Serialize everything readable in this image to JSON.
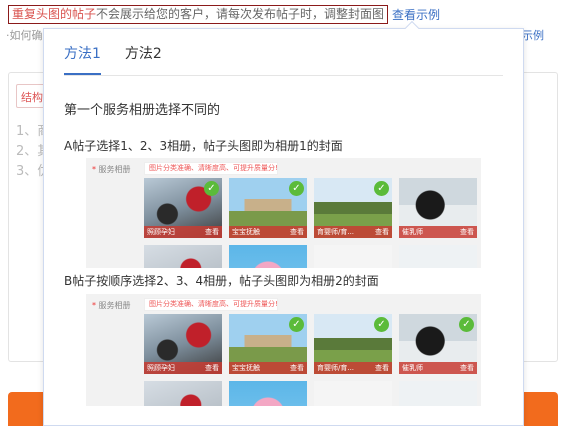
{
  "notice": {
    "highlight": "重复头图的帖子",
    "rest": "不会展示给您的客户，请每次发布帖子时，调整封面图",
    "link": "查看示例"
  },
  "sub": {
    "left": "·如何确",
    "right": "示例"
  },
  "background": {
    "tag": "结构",
    "lines": [
      "1、商",
      "2、其",
      "3、优"
    ]
  },
  "popup": {
    "tabs": [
      "方法1",
      "方法2"
    ],
    "active_tab": 0,
    "title": "第一个服务相册选择不同的",
    "section_a": "A帖子选择1、2、3相册，帖子头图即为相册1的封面",
    "section_b": "B帖子按顺序选择2、3、4相册，帖子头图即为相册2的封面",
    "mock": {
      "label": "服务相册",
      "hint": "图片分类准确、清晰度高、可提升质量分!",
      "view": "查看",
      "tiles": [
        "照顾孕妇",
        "宝宝抚触",
        "育婴师/育...",
        "催乳师"
      ],
      "checked_a": [
        true,
        true,
        true,
        false
      ],
      "checked_b": [
        false,
        true,
        true,
        true
      ]
    }
  },
  "colors": {
    "accent": "#3a6fc4",
    "highlight": "#d9534f",
    "orange": "#f26b1d",
    "check": "#5bbb3a"
  }
}
